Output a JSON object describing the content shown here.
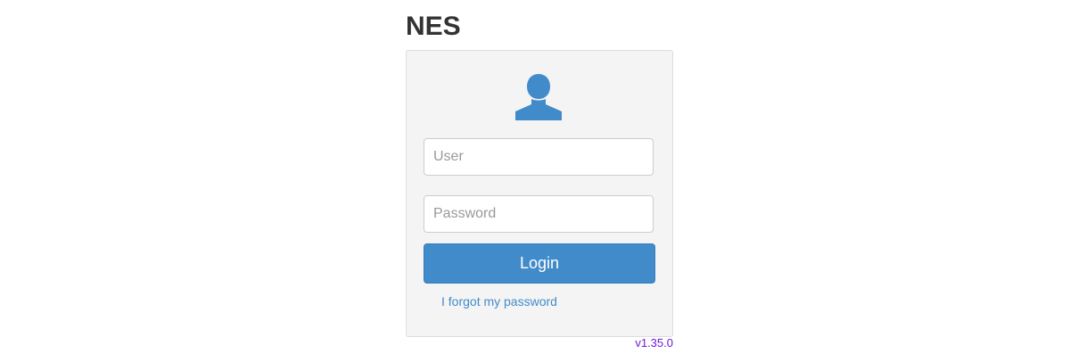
{
  "app": {
    "title": "NES"
  },
  "login": {
    "avatar_icon": "user-icon",
    "user_placeholder": "User",
    "user_value": "",
    "password_placeholder": "Password",
    "password_value": "",
    "login_label": "Login",
    "forgot_password_label": "I forgot my password"
  },
  "footer": {
    "version": "v1.35.0"
  },
  "colors": {
    "accent": "#428bca",
    "version_text": "#6a1bd8",
    "panel_bg": "#f4f4f4"
  }
}
